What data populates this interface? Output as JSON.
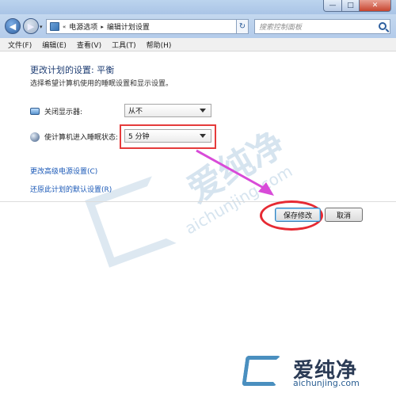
{
  "window": {
    "controls": {
      "minimize": "—",
      "maximize": "□",
      "close": "✕"
    }
  },
  "nav": {
    "history_glyph": "▾",
    "address_prefix": "«",
    "crumbs": [
      "电源选项",
      "编辑计划设置"
    ],
    "crumb_sep": "▸",
    "search_placeholder": "搜索控制面板"
  },
  "menu": [
    "文件(F)",
    "编辑(E)",
    "查看(V)",
    "工具(T)",
    "帮助(H)"
  ],
  "page": {
    "title": "更改计划的设置: 平衡",
    "subtitle": "选择希望计算机使用的睡眠设置和显示设置。",
    "display_label": "关闭显示器:",
    "display_value": "从不",
    "sleep_label": "使计算机进入睡眠状态:",
    "sleep_value": "5 分钟",
    "link_advanced": "更改高级电源设置(C)",
    "link_restore": "还原此计划的默认设置(R)",
    "save_button": "保存修改",
    "cancel_button": "取消"
  },
  "watermark": {
    "cn": "爱纯净",
    "en": "aichunjing.com"
  },
  "colors": {
    "highlight": "#e53b3b",
    "arrow": "#d84bd8",
    "link": "#1b59b7",
    "title": "#1e3d73"
  }
}
